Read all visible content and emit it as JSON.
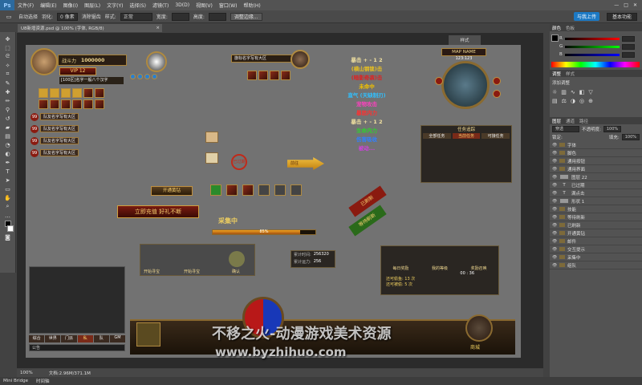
{
  "app": {
    "logo": "Ps",
    "menu": [
      "文件(F)",
      "编辑(E)",
      "图像(I)",
      "图层(L)",
      "文字(Y)",
      "选择(S)",
      "滤镜(T)",
      "3D(D)",
      "视图(V)",
      "窗口(W)",
      "帮助(H)"
    ],
    "window_controls": [
      "—",
      "□",
      "✕"
    ]
  },
  "options_bar": {
    "auto_select": "自动选择",
    "feather_label": "羽化:",
    "feather_value": "0 像素",
    "anti_alias": "消除锯齿",
    "style_label": "样式:",
    "style_value": "正常",
    "width_label": "宽度:",
    "height_label": "高度:",
    "refine_edge": "调整边缘...",
    "share": "与我上传",
    "workspace": "基本功能"
  },
  "document": {
    "tab_title": "U8新增资源.psd @ 100% (字体, RGB/8)",
    "dock_label": "样式"
  },
  "status_bar": {
    "zoom": "100%",
    "doc_size": "文档:2.96M/371.1M"
  },
  "bottom_bar": {
    "mini_bridge": "Mini Bridge",
    "timeline": "时间轴"
  },
  "panels": {
    "color_tabs": [
      "颜色",
      "色板"
    ],
    "channels": [
      "R",
      "G",
      "B"
    ],
    "adjust_tabs": [
      "调整",
      "样式"
    ],
    "adjust_title": "添加调整",
    "layers_tabs": [
      "图层",
      "通道",
      "路径"
    ],
    "blend_mode": "穿透",
    "opacity_label": "不透明度:",
    "opacity_value": "100%",
    "lock_label": "锁定:",
    "fill_label": "填充:",
    "fill_value": "100%",
    "layers": [
      {
        "name": "字体",
        "type": "folder"
      },
      {
        "name": "脚色",
        "type": "folder"
      },
      {
        "name": "通用按钮",
        "type": "folder"
      },
      {
        "name": "通用界面",
        "type": "folder"
      },
      {
        "name": "图层 22",
        "type": "layer"
      },
      {
        "name": "已过期",
        "type": "text"
      },
      {
        "name": "满点击",
        "type": "text"
      },
      {
        "name": "形状 1",
        "type": "layer"
      },
      {
        "name": "技能",
        "type": "folder"
      },
      {
        "name": "等待刷新",
        "type": "folder"
      },
      {
        "name": "已刷新",
        "type": "folder"
      },
      {
        "name": "开通黄钻",
        "type": "folder"
      },
      {
        "name": "邮件",
        "type": "folder"
      },
      {
        "name": "交互提示",
        "type": "folder"
      },
      {
        "name": "采集中",
        "type": "folder"
      },
      {
        "name": "组队",
        "type": "folder"
      }
    ]
  },
  "game": {
    "power_label": "战斗力",
    "power_value": "1000000",
    "vip": "VIP 12",
    "char_tag": "[100区]名字一般八个汉字",
    "party_member": "队友名字写有大区",
    "party_rows": [
      "队友名字写有大区",
      "队友名字写有大区",
      "队友名字写有大区",
      "队友名字写有大区"
    ],
    "level_tag": "99",
    "target_name": "旗标名字写有大区",
    "map_name": "MAP NAME",
    "map_coords": "123:123",
    "attr_lines": [
      {
        "text": "暴击 + - 1 2",
        "color": "#f0e0a0"
      },
      {
        "text": "(横山钢锁)击",
        "color": "#e8c020"
      },
      {
        "text": "(暗影奇袭)击",
        "color": "#e02020"
      },
      {
        "text": "未命中",
        "color": "#f0c000"
      },
      {
        "text": "直气 (天缺制刃)",
        "color": "#30c0ff"
      },
      {
        "text": "宠物攻击",
        "color": "#ff40c0"
      },
      {
        "text": "暴怒内力",
        "color": "#ff3030"
      },
      {
        "text": "暴击 + - 1 2",
        "color": "#f0e0a0"
      },
      {
        "text": "生命内力",
        "color": "#30d030"
      },
      {
        "text": "伤害吸收",
        "color": "#3080ff"
      },
      {
        "text": "被动...",
        "color": "#d040e0"
      }
    ],
    "task_title": "任务追踪",
    "task_tabs": [
      "全部任务",
      "当前任务",
      "可接任务"
    ],
    "banner_refreshed": "已刷新",
    "banner_waiting": "等待刷新",
    "vip_button": "开通黄钻",
    "recharge_button": "立即充值 好礼不断",
    "gathering": "采集中",
    "gather_percent": "85%",
    "progress_fraction": 0.85,
    "go_label": "前往",
    "stamp_label": "已过期",
    "chat_tabs": [
      "综合",
      "世界",
      "门派",
      "私",
      "队",
      "GM"
    ],
    "chat_input": "公告",
    "stat_rows": [
      {
        "label": "累计时间:",
        "value": "256320"
      },
      {
        "label": "累计运力:",
        "value": "256"
      }
    ],
    "buff_labels": [
      "每日奖励",
      "我的等级",
      "奖励召唤"
    ],
    "buff_time": "00 : 36",
    "remaining": [
      {
        "label": "还可偷鱼:",
        "value": "13 次"
      },
      {
        "label": "还可被偷:",
        "value": "5 次"
      }
    ],
    "portrait_labels": [
      "开始寻宝",
      "开始寻宝"
    ],
    "confirm_label": "确认",
    "shop_label": "商城",
    "watermark_cn": "不移之火-动漫游戏美术资源",
    "watermark_url": "www.byzhihuo.com"
  }
}
